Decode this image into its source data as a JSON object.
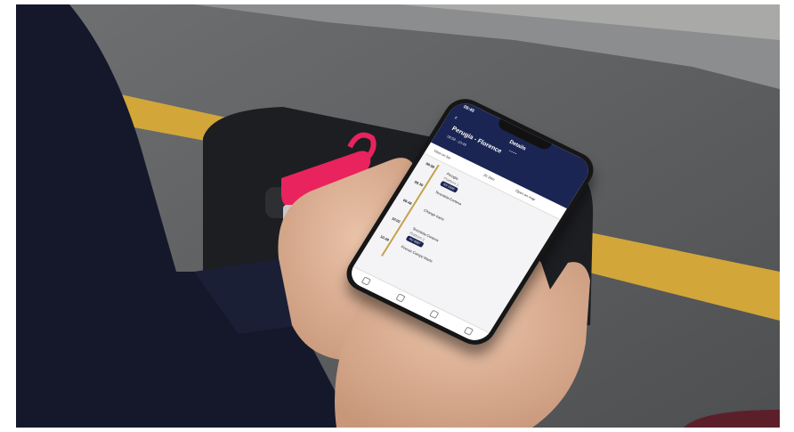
{
  "app": {
    "status_time": "09:45",
    "header_title": "Details",
    "route_title": "Perugia - Florence",
    "route_subtitle": "08:58 - 10:49",
    "toolbar_left": "View on list",
    "toolbar_mid": "2h 34m",
    "toolbar_right": "Open on map"
  },
  "stops": [
    {
      "time": "08:58",
      "name": "Perugia",
      "sub": "Platform 1",
      "tag": "RV 2345"
    },
    {
      "time": "09:30",
      "name": "Terontola-Cortona",
      "sub": "",
      "tag": ""
    },
    {
      "time": "09:48",
      "name": "Change trains",
      "sub": "",
      "tag": ""
    },
    {
      "time": "10:02",
      "name": "Terontola-Cortona",
      "sub": "Platform 2",
      "tag": "RV 4567"
    },
    {
      "time": "10:49",
      "name": "Firenze Campo Marte",
      "sub": "",
      "tag": ""
    }
  ],
  "colors": {
    "header": "#1b2553",
    "accent": "#c5a14b",
    "luggage_tag": "#e8235e",
    "road_line": "#d3a63a"
  }
}
